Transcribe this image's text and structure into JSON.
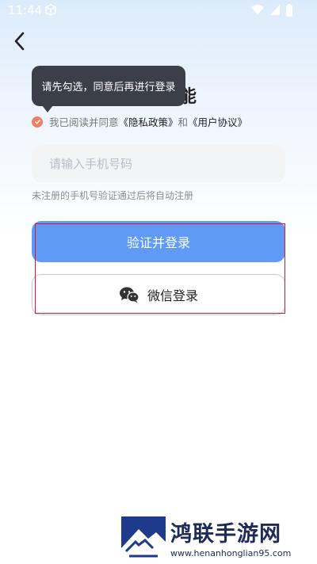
{
  "status_bar": {
    "time": "11:44"
  },
  "header": {
    "title_partial": "能"
  },
  "tooltip": {
    "text": "请先勾选，同意后再进行登录"
  },
  "agreement": {
    "prefix": "我已阅读并同意",
    "privacy_link": "《隐私政策》",
    "conjunction": "和",
    "terms_link": "《用户协议》"
  },
  "phone_field": {
    "placeholder": "请输入手机号码",
    "value": ""
  },
  "hint": "未注册的手机号验证通过后将自动注册",
  "buttons": {
    "verify_login": "验证并登录",
    "wechat_login": "微信登录"
  },
  "watermark": {
    "name": "鸿联手游网",
    "url": "www.henanhonglian95.com"
  },
  "colors": {
    "primary": "#5f9bf6",
    "check": "#f27e63",
    "tooltip_bg": "#3b3f48",
    "highlight_frame": "#d8162f"
  },
  "icons": {
    "back": "chevron-left-icon",
    "wechat": "wechat-icon",
    "wifi": "wifi-icon",
    "signal": "signal-icon",
    "battery": "battery-icon"
  }
}
